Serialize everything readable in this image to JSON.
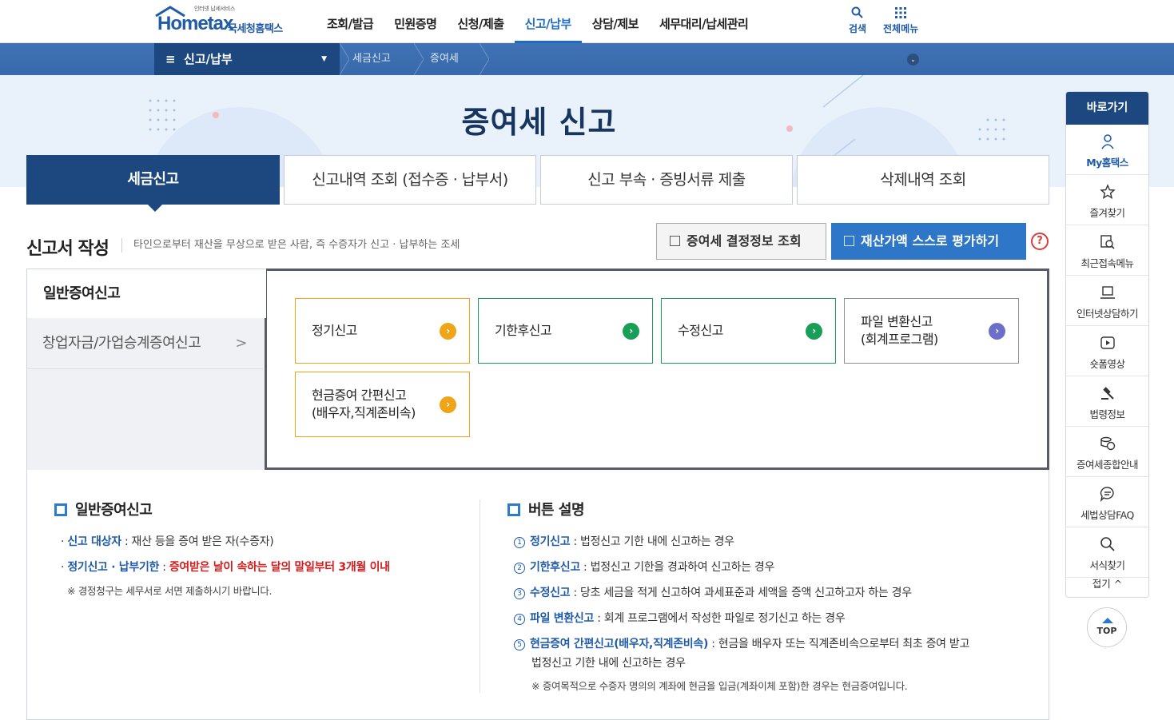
{
  "logo": {
    "tagline": "인터넷 납세서비스",
    "brand": "Hometax",
    "org": "국세청홈택스"
  },
  "gnb": {
    "items": [
      "조회/발급",
      "민원증명",
      "신청/제출",
      "신고/납부",
      "상담/제보",
      "세무대리/납세관리"
    ],
    "active_index": 3,
    "search_label": "검색",
    "allmenu_label": "전체메뉴"
  },
  "lnb": {
    "current": "신고/납부",
    "crumbs": [
      "세금신고",
      "증여세"
    ]
  },
  "page_title": "증여세 신고",
  "tabs": [
    "세금신고",
    "신고내역 조회 (접수증 · 납부서)",
    "신고 부속 · 증빙서류 제출",
    "삭제내역 조회"
  ],
  "section": {
    "title": "신고서 작성",
    "desc": "타인으로부터 재산을 무상으로 받은 사람, 즉 수증자가 신고 · 납부하는 조세",
    "btn_info": "증여세 결정정보 조회",
    "btn_self": "재산가액 스스로 평가하기",
    "help": "?"
  },
  "left_nav": {
    "item1": "일반증여신고",
    "item2": "창업자금/가업승계증여신고"
  },
  "report_buttons": {
    "b1": "정기신고",
    "b2": "기한후신고",
    "b3": "수정신고",
    "b4_l1": "파일 변환신고",
    "b4_l2": "(회계프로그램)",
    "b5_l1": "현금증여 간편신고",
    "b5_l2": "(배우자,직계존비속)"
  },
  "info_left": {
    "title": "일반증여신고",
    "l1_key": "신고 대상자",
    "l1_val": " : 재산 등을 증여 받은 자(수증자)",
    "l2_key": "정기신고 · 납부기한",
    "l2_sep": " : ",
    "l2_val": "증여받은 날이 속하는 달의 말일부터 3개월 이내",
    "note": "※ 경정청구는 세무서로 서면 제출하시기 바랍니다."
  },
  "info_right": {
    "title": "버튼 설명",
    "items": [
      {
        "n": "1",
        "k": "정기신고",
        "v": " : 법정신고 기한 내에 신고하는 경우"
      },
      {
        "n": "2",
        "k": "기한후신고",
        "v": " : 법정신고 기한을 경과하여 신고하는 경우"
      },
      {
        "n": "3",
        "k": "수정신고",
        "v": " : 당초 세금을 적게 신고하여 과세표준과 세액을 증액 신고하고자 하는 경우"
      },
      {
        "n": "4",
        "k": "파일 변환신고",
        "v": " : 회계 프로그램에서 작성한 파일로 정기신고 하는 경우"
      },
      {
        "n": "5",
        "k": "현금증여 간편신고(배우자,직계존비속)",
        "v": " : 현금을 배우자 또는 직계존비속으로부터 최초 증여 받고"
      }
    ],
    "item5_cont": "법정신고 기한 내에 신고하는 경우",
    "note": "※ 증여목적으로 수증자 명의의 계좌에 현금을 입금(계좌이체 포함)한 경우는 현금증여입니다."
  },
  "quick": {
    "header": "바로가기",
    "items": [
      "My홈택스",
      "즐겨찾기",
      "최근접속메뉴",
      "인터넷상담하기",
      "숏폼영상",
      "법령정보",
      "증여세종합안내",
      "세법상담FAQ",
      "서식찾기"
    ],
    "fold": "접기 ^",
    "top": "TOP"
  },
  "colors": {
    "navy": "#1c477f",
    "blue": "#2d76c8",
    "orange": "#f0a418",
    "green": "#179e57",
    "purple": "#6b6fc9",
    "red": "#d61c1c"
  }
}
